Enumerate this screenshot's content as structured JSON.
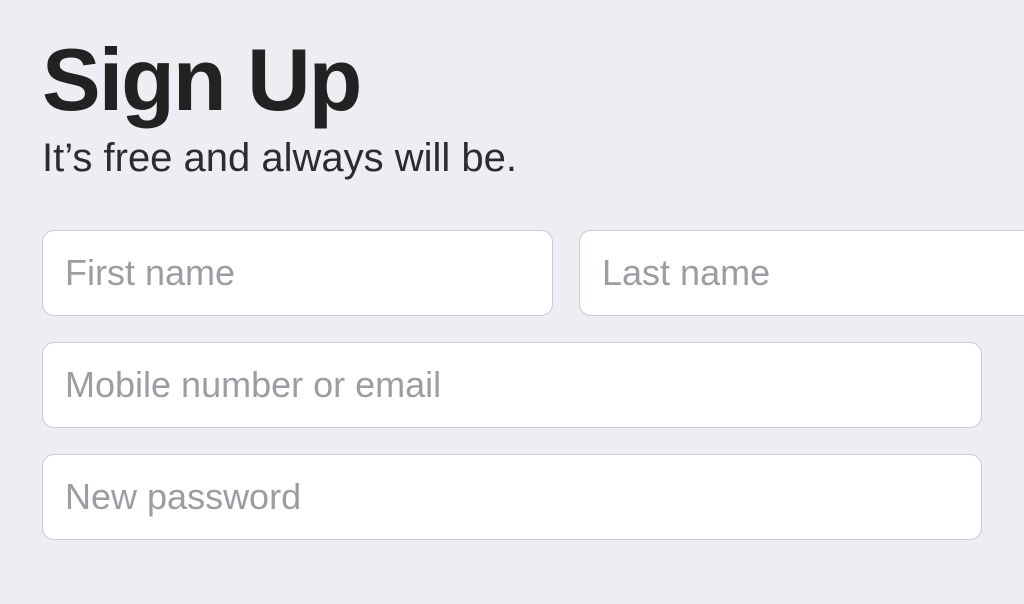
{
  "header": {
    "title": "Sign Up",
    "subtitle": "It’s free and always will be."
  },
  "form": {
    "first_name": {
      "placeholder": "First name",
      "value": ""
    },
    "last_name": {
      "placeholder": "Last name",
      "value": ""
    },
    "contact": {
      "placeholder": "Mobile number or email",
      "value": ""
    },
    "password": {
      "placeholder": "New password",
      "value": ""
    }
  }
}
